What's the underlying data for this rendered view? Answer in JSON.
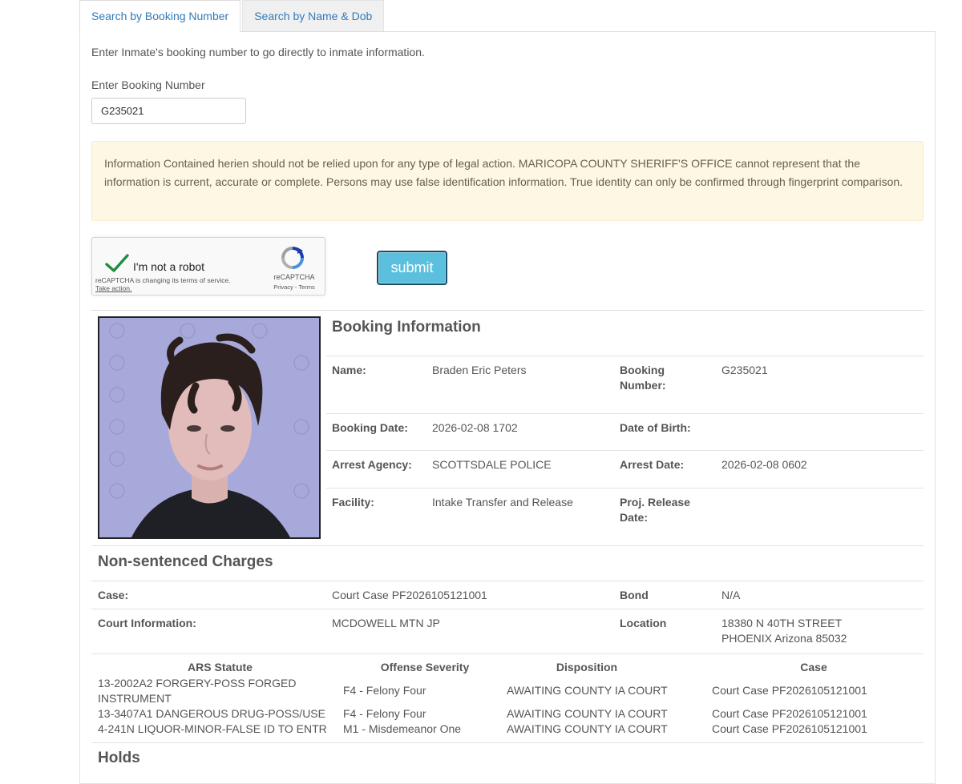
{
  "tabs": [
    {
      "label": "Search by Booking Number",
      "active": true
    },
    {
      "label": "Search by Name & Dob",
      "active": false
    }
  ],
  "search": {
    "intro": "Enter Inmate's booking number to go directly to inmate information.",
    "label": "Enter Booking Number",
    "value": "G235021"
  },
  "disclaimer": "Information Contained herien should not be relied upon for any type of legal action. MARICOPA COUNTY SHERIFF'S OFFICE cannot represent that the information is current, accurate or complete. Persons may use false identification information. True identity can only be confirmed through fingerprint comparison.",
  "recaptcha": {
    "label": "I'm not a robot",
    "notice": "reCAPTCHA is changing its terms of service.",
    "notice_link": "Take action.",
    "brand": "reCAPTCHA",
    "privacy": "Privacy - Terms"
  },
  "submit_label": "submit",
  "booking": {
    "title": "Booking Information",
    "name_label": "Name:",
    "name": "Braden Eric Peters",
    "booking_number_label": "Booking Number:",
    "booking_number": "G235021",
    "booking_date_label": "Booking Date:",
    "booking_date": "2026-02-08 1702",
    "dob_label": "Date of Birth:",
    "dob": "",
    "arrest_agency_label": "Arrest Agency:",
    "arrest_agency": "SCOTTSDALE POLICE",
    "arrest_date_label": "Arrest Date:",
    "arrest_date": "2026-02-08 0602",
    "facility_label": "Facility:",
    "facility": "Intake Transfer and Release",
    "release_label": "Proj. Release Date:",
    "release": ""
  },
  "charges": {
    "title": "Non-sentenced Charges",
    "case_label": "Case:",
    "case": "Court Case PF2026105121001",
    "bond_label": "Bond",
    "bond": "N/A",
    "court_label": "Court Information:",
    "court": "MCDOWELL MTN JP",
    "location_label": "Location",
    "location": "18380 N 40TH STREET PHOENIX Arizona 85032",
    "columns": [
      "ARS Statute",
      "Offense Severity",
      "Disposition",
      "Case"
    ],
    "rows": [
      {
        "statute": "13-2002A2 FORGERY-POSS FORGED INSTRUMENT",
        "severity": "F4 - Felony Four",
        "disposition": "AWAITING COUNTY IA COURT",
        "case": "Court Case PF2026105121001"
      },
      {
        "statute": "13-3407A1 DANGEROUS DRUG-POSS/USE",
        "severity": "F4 - Felony Four",
        "disposition": "AWAITING COUNTY IA COURT",
        "case": "Court Case PF2026105121001"
      },
      {
        "statute": "4-241N LIQUOR-MINOR-FALSE ID TO ENTR",
        "severity": "M1 - Misdemeanor One",
        "disposition": "AWAITING COUNTY IA COURT",
        "case": "Court Case PF2026105121001"
      }
    ]
  },
  "holds_title": "Holds",
  "colors": {
    "link": "#337ab7",
    "warning_bg": "#fcf8e3",
    "button": "#5bc0de"
  }
}
